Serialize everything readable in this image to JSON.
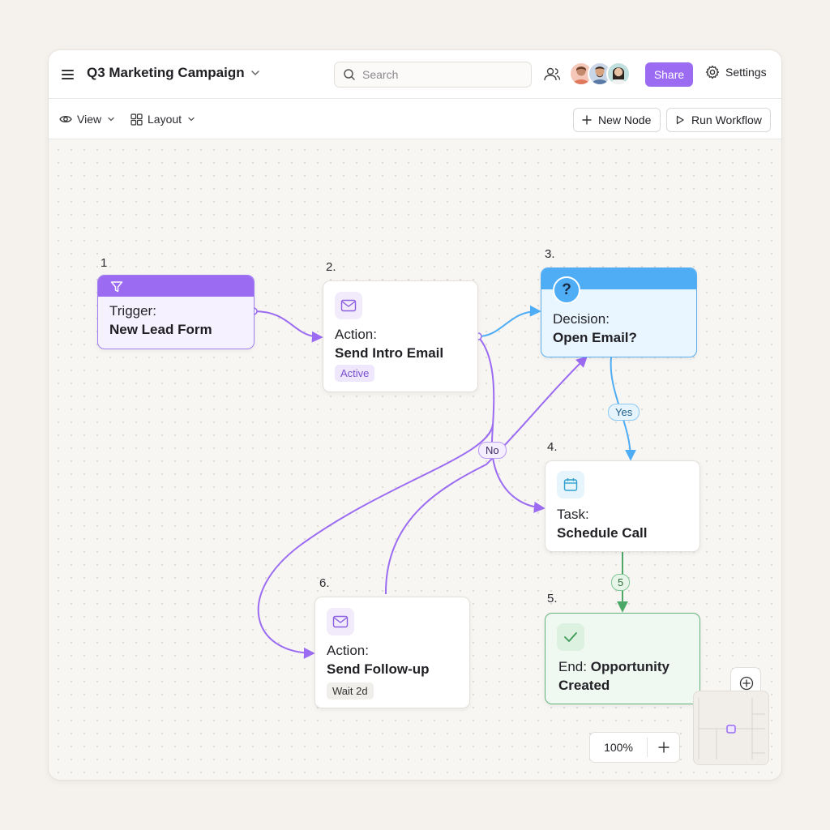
{
  "header": {
    "title": "Q3 Marketing Campaign",
    "search_placeholder": "Search",
    "share_label": "Share",
    "settings_label": "Settings"
  },
  "toolbar": {
    "view_label": "View",
    "layout_label": "Layout",
    "new_node_label": "New Node",
    "run_workflow_label": "Run Workflow"
  },
  "nodes": [
    {
      "number": "1",
      "kind": "Trigger:",
      "name": "New Lead Form",
      "icon": "filter-icon"
    },
    {
      "number": "2.",
      "kind": "Action:",
      "name": "Send Intro Email",
      "badge": "Active",
      "icon": "mail-icon"
    },
    {
      "number": "3.",
      "kind": "Decision:",
      "name": "Open Email?",
      "icon": "question-icon"
    },
    {
      "number": "4.",
      "kind": "Task:",
      "name": "Schedule Call",
      "icon": "calendar-icon"
    },
    {
      "number": "5.",
      "kind": "End:",
      "name_line1": "Opportunity",
      "name_line2": "Created",
      "icon": "check-icon"
    },
    {
      "number": "6.",
      "kind": "Action:",
      "name": "Send Follow-up",
      "badge": "Wait 2d",
      "icon": "mail-icon"
    }
  ],
  "edge_labels": {
    "yes": "Yes",
    "no": "No",
    "five": "5"
  },
  "zoom": {
    "level": "100%"
  },
  "colors": {
    "accent": "#9b6cf2",
    "decision": "#4eadf5",
    "success": "#62b47a"
  }
}
